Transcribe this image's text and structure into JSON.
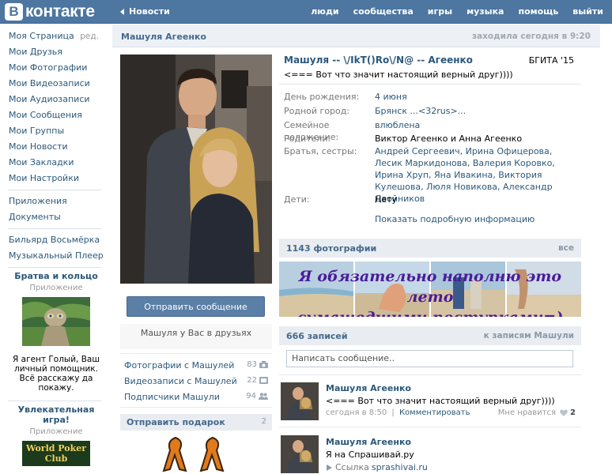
{
  "header": {
    "logo_letter": "B",
    "logo_text": "контакте",
    "back_link": "Новости",
    "nav": [
      "люди",
      "сообщества",
      "игры",
      "музыка",
      "помощь",
      "выйти"
    ]
  },
  "sidebar": {
    "edit_label": "ред.",
    "items": [
      "Моя Страница",
      "Мои Друзья",
      "Мои Фотографии",
      "Мои Видеозаписи",
      "Мои Аудиозаписи",
      "Мои Сообщения",
      "Мои Группы",
      "Мои Новости",
      "Мои Закладки",
      "Мои Настройки"
    ],
    "items2": [
      "Приложения",
      "Документы"
    ],
    "items3": [
      "Бильярд Восьмёрка",
      "Музыкальный Плеер"
    ],
    "ad1": {
      "title": "Братва и кольцо",
      "subtitle": "Приложение",
      "text": "Я агент Голый, Ваш личный помощник. Всё расскажу да покажу."
    },
    "ad2": {
      "title": "Увлекательная игра!",
      "subtitle": "Приложение",
      "logo_text": "World Poker Club"
    }
  },
  "page": {
    "name": "Машуля Агеенко",
    "last_seen": "заходила сегодня в 9:20"
  },
  "profile": {
    "full_name": "Машуля -- \\/IkT()Ro\\/N@ -- Агеенко",
    "university": "БГИТА '15",
    "status": "<=== Вот что значит настоящий верный друг))))",
    "rows": [
      {
        "label": "День рождения:",
        "value": "4 июня"
      },
      {
        "label": "Родной город:",
        "value": "Брянск ...<32rus>..."
      },
      {
        "label": "Семейное положение:",
        "value": "влюблена"
      },
      {
        "label": "Родители:",
        "value": "Виктор Агеенко и Анна Агеенко"
      },
      {
        "label": "Братья, сестры:",
        "value": "Андрей Сергеевич, Ирина Офицерова, Лесик Маркидонова, Валерия Коровко, Ирина Хруп, Яна Ивакина, Виктория Кулешова, Люля Новикова, Александр Двойников"
      },
      {
        "label": "Дети:",
        "value": "Нету"
      }
    ],
    "more_info": "Показать подробную информацию"
  },
  "left_column": {
    "send_message": "Отправить сообщение",
    "friend_note": "Машуля у Вас в друзьях",
    "counters": [
      {
        "label": "Фотографии с Машулей",
        "count": "83"
      },
      {
        "label": "Видеозаписи с Машулей",
        "count": "22"
      },
      {
        "label": "Подписчики Машули",
        "count": "94"
      }
    ],
    "gifts_title": "Отправить подарок",
    "gifts_count": "2"
  },
  "photos": {
    "title": "1143 фотографии",
    "all_link": "все",
    "overlay_text_1": "Я обязательно наполню это лето",
    "overlay_text_2": "сумашедшими поступками=)"
  },
  "wall": {
    "title": "666 записей",
    "link": "к записям Машули",
    "placeholder": "Написать сообщение..",
    "posts": [
      {
        "author": "Машуля Агеенко",
        "text": "<=== Вот что значит настоящий верный друг))))",
        "time": "сегодня в 8:50",
        "separator": "|",
        "comment": "Комментировать",
        "like_label": "Мне нравится",
        "likes": "2"
      },
      {
        "author": "Машуля Агеенко",
        "text": "Я на Спрашивай.ру",
        "link_label": "Ссылка",
        "link_url": "sprashivai.ru"
      }
    ]
  },
  "colors": {
    "header_blue": "#4d76a0",
    "link": "#2b587a",
    "section_head": "#e9edf1",
    "button": "#5b7fa6"
  }
}
